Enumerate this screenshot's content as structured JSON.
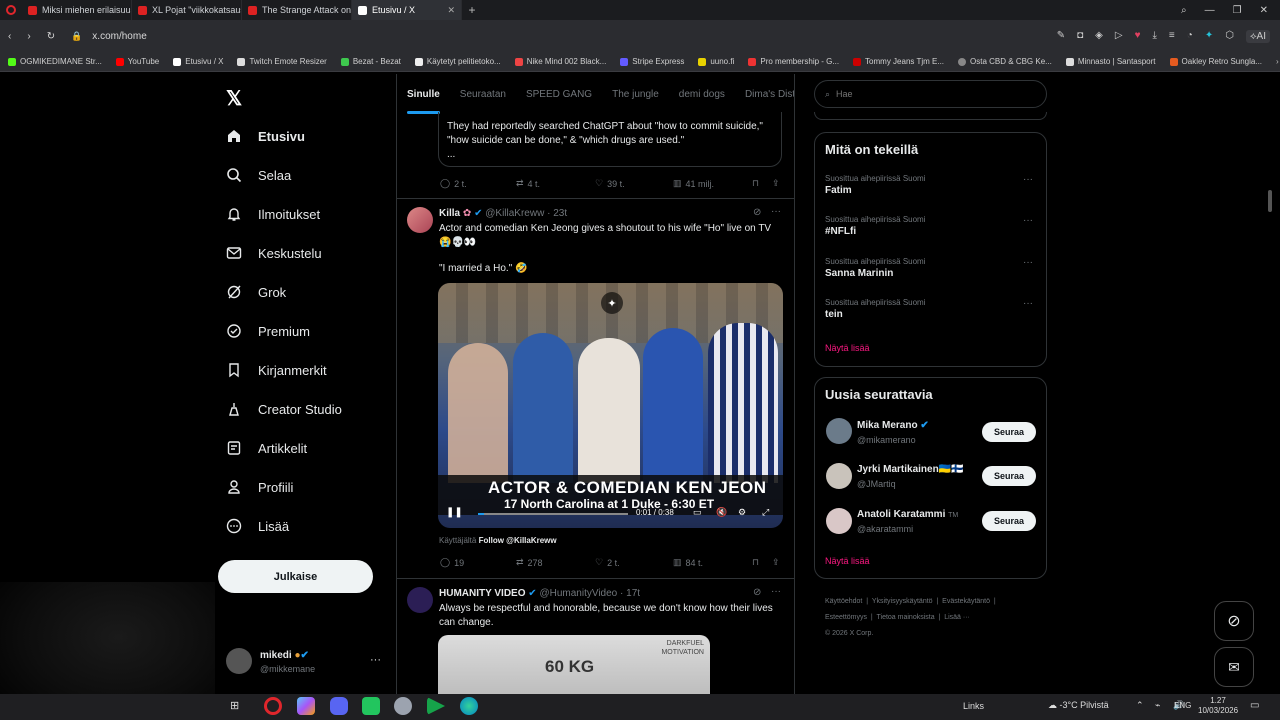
{
  "browser": {
    "tabs": [
      {
        "title": "Miksi miehen erilaisuus ko"
      },
      {
        "title": "XL Pojat \"viikkokatsaus\" B"
      },
      {
        "title": "The Strange Attack on Fli"
      },
      {
        "title": "Etusivu / X"
      }
    ],
    "url": "x.com/home",
    "bookmarks": [
      "OGMIKEDIMANE Str...",
      "YouTube",
      "Etusivu / X",
      "Twitch Emote Resizer",
      "Bezat - Bezat",
      "Käytetyt pelitietoko...",
      "Nike Mind 002 Black...",
      "Stripe Express",
      "uuno.fi",
      "Pro membership - G...",
      "Tommy Jeans Tjm E...",
      "Osta CBD & CBG Ke...",
      "Minnasto | Santasport",
      "Oakley Retro Sungla..."
    ]
  },
  "nav": {
    "items": [
      {
        "label": "Etusivu",
        "icon": "home-icon"
      },
      {
        "label": "Selaa",
        "icon": "search-icon"
      },
      {
        "label": "Ilmoitukset",
        "icon": "bell-icon"
      },
      {
        "label": "Keskustelu",
        "icon": "mail-icon"
      },
      {
        "label": "Grok",
        "icon": "grok-icon"
      },
      {
        "label": "Premium",
        "icon": "premium-icon"
      },
      {
        "label": "Kirjanmerkit",
        "icon": "bookmark-icon"
      },
      {
        "label": "Creator Studio",
        "icon": "creator-icon"
      },
      {
        "label": "Artikkelit",
        "icon": "article-icon"
      },
      {
        "label": "Profiili",
        "icon": "profile-icon"
      },
      {
        "label": "Lisää",
        "icon": "more-icon"
      }
    ],
    "post_label": "Julkaise",
    "account": {
      "name": "mikedi",
      "handle": "@mikkemane"
    }
  },
  "feed": {
    "tabs": [
      "Sinulle",
      "Seuraatan",
      "SPEED GANG",
      "The jungle",
      "demi dogs",
      "Dima's Dist"
    ],
    "prev_tweet": {
      "text1": "They had reportedly searched ChatGPT about \"how to commit suicide,\"",
      "text2": "\"how suicide can be done,\" & \"which drugs are used.\"",
      "text3": "...",
      "replies": "2 t.",
      "reposts": "4 t.",
      "likes": "39 t.",
      "views": "41 milj."
    },
    "tweet1": {
      "name": "Killa",
      "handle": "@KillaKreww",
      "time": "· 23t",
      "text1": "Actor and comedian Ken Jeong gives a shoutout to his wife \"Ho\" live on TV",
      "emojis1": "😭💀👀",
      "text2": "\"I married a Ho.\" 🤣",
      "video_caption1": "ACTOR & COMEDIAN KEN JEON",
      "video_caption2": "17 North Carolina at 1 Duke - 6:30 ET",
      "video_time": "0:01 / 0:38",
      "source_prefix": "Käyttäjältä",
      "source_link": "Follow @KillaKreww",
      "replies": "19",
      "reposts": "278",
      "likes": "2 t.",
      "views": "84 t."
    },
    "tweet2": {
      "name": "HUMANITY VIDEO",
      "handle": "@HumanityVideo",
      "time": "· 17t",
      "text1": "Always be respectful and honorable, because we don't know how their lives",
      "text2": "can change.",
      "image_label": "60 KG",
      "image_brand1": "DARKFUEL",
      "image_brand2": "MOTIVATION"
    }
  },
  "sidebar": {
    "search_placeholder": "Hae",
    "trends_title": "Mitä on tekeillä",
    "trends": [
      {
        "context": "Suosittua aihepiirissä Suomi",
        "name": "Fatim"
      },
      {
        "context": "Suosittua aihepiirissä Suomi",
        "name": "#NFLfi"
      },
      {
        "context": "Suosittua aihepiirissä Suomi",
        "name": "Sanna Marinin"
      },
      {
        "context": "Suosittua aihepiirissä Suomi",
        "name": "tein"
      }
    ],
    "show_more": "Näytä lisää",
    "follow_title": "Uusia seurattavia",
    "follow": [
      {
        "name": "Mika Merano",
        "handle": "@mikamerano",
        "button": "Seuraa"
      },
      {
        "name": "Jyrki Martikainen🇺🇦🇫🇮",
        "handle": "@JMartiq",
        "button": "Seuraa"
      },
      {
        "name": "Anatoli Karatammi",
        "handle": "@akaratammi",
        "button": "Seuraa"
      }
    ],
    "show_more2": "Näytä lisää",
    "footer": [
      "Käyttöehdot",
      "Yksityisyyskäytäntö",
      "Evästekäytäntö",
      "Esteettömyys",
      "Tietoa mainoksista",
      "Lisää ···",
      "© 2026 X Corp."
    ]
  },
  "taskbar": {
    "links": "Links",
    "weather": "-3°C  Pilvistä",
    "lang": "ENG",
    "time": "1.27",
    "date": "10/03/2026"
  }
}
